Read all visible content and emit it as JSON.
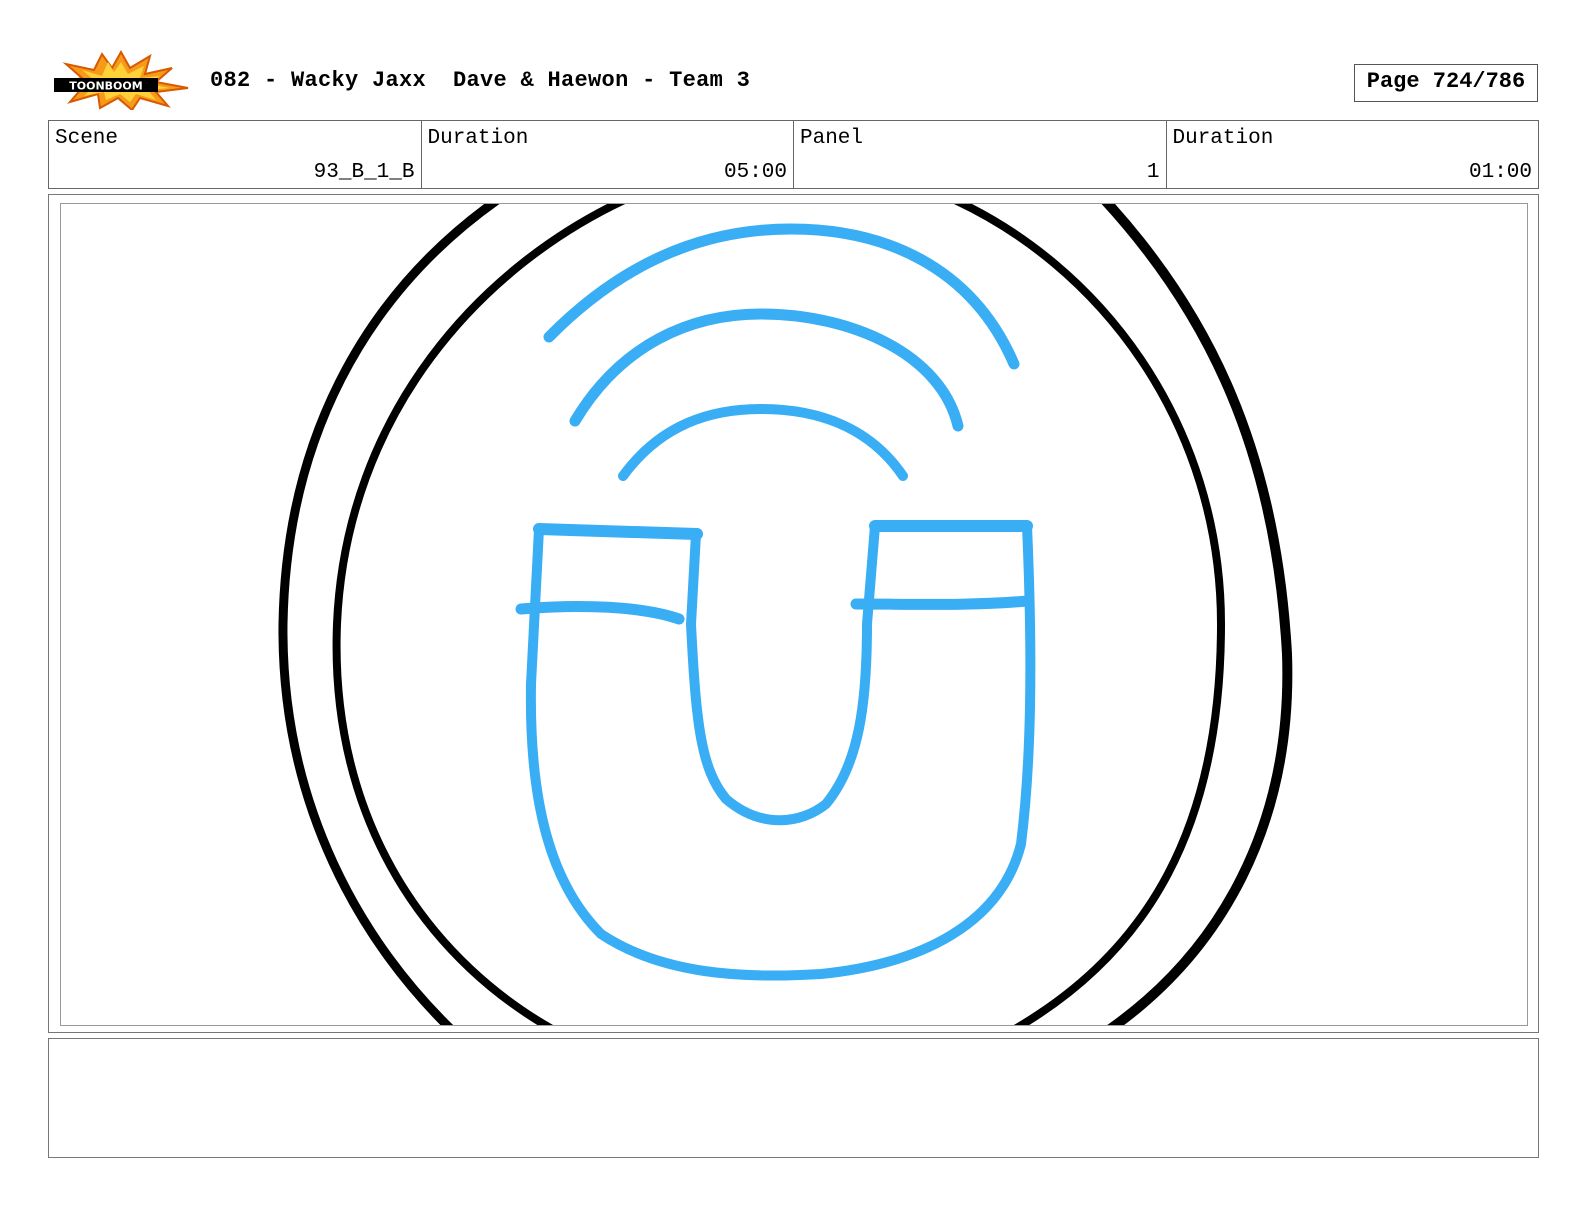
{
  "header": {
    "logo_text": "TOONBOOM",
    "title": "082 - Wacky Jaxx  Dave & Haewon - Team 3",
    "page": "Page 724/786"
  },
  "info": {
    "scene_label": "Scene",
    "scene_value": "93_B_1_B",
    "scene_duration_label": "Duration",
    "scene_duration_value": "05:00",
    "panel_label": "Panel",
    "panel_value": "1",
    "panel_duration_label": "Duration",
    "panel_duration_value": "01:00"
  },
  "drawing": {
    "description_icon": "magnet-icon",
    "outline_color": "#000000",
    "magnet_color": "#3aaef5"
  },
  "notes": {
    "text": ""
  }
}
